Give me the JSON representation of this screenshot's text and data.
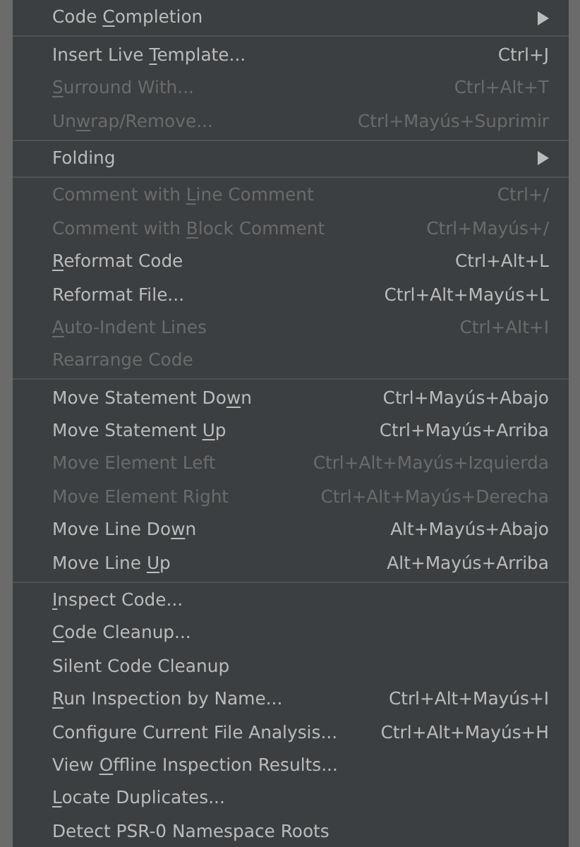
{
  "menu": {
    "sections": [
      [
        {
          "label": {
            "before": "Code ",
            "key": "C",
            "after": "ompletion"
          },
          "disabled": false,
          "submenu": true
        }
      ],
      [
        {
          "label": {
            "before": "Insert Live ",
            "key": "T",
            "after": "emplate..."
          },
          "shortcut": "Ctrl+J",
          "disabled": false
        },
        {
          "label": {
            "key": "S",
            "after": "urround With..."
          },
          "shortcut": "Ctrl+Alt+T",
          "disabled": true
        },
        {
          "label": {
            "before": "Un",
            "key": "w",
            "after": "rap/Remove..."
          },
          "shortcut": "Ctrl+Mayús+Suprimir",
          "disabled": true
        }
      ],
      [
        {
          "label": {
            "before": "Folding"
          },
          "disabled": false,
          "submenu": true
        }
      ],
      [
        {
          "label": {
            "before": "Comment with ",
            "key": "L",
            "after": "ine Comment"
          },
          "shortcut": "Ctrl+/",
          "disabled": true
        },
        {
          "label": {
            "before": "Comment with ",
            "key": "B",
            "after": "lock Comment"
          },
          "shortcut": "Ctrl+Mayús+/",
          "disabled": true
        },
        {
          "label": {
            "key": "R",
            "after": "eformat Code"
          },
          "shortcut": "Ctrl+Alt+L",
          "disabled": false
        },
        {
          "label": {
            "before": "Reformat File..."
          },
          "shortcut": "Ctrl+Alt+Mayús+L",
          "disabled": false
        },
        {
          "label": {
            "key": "A",
            "after": "uto-Indent Lines"
          },
          "shortcut": "Ctrl+Alt+I",
          "disabled": true
        },
        {
          "label": {
            "before": "Rearrange Code"
          },
          "disabled": true
        }
      ],
      [
        {
          "label": {
            "before": "Move Statement Do",
            "key": "w",
            "after": "n"
          },
          "shortcut": "Ctrl+Mayús+Abajo",
          "disabled": false
        },
        {
          "label": {
            "before": "Move Statement ",
            "key": "U",
            "after": "p"
          },
          "shortcut": "Ctrl+Mayús+Arriba",
          "disabled": false
        },
        {
          "label": {
            "before": "Move Element Left"
          },
          "shortcut": "Ctrl+Alt+Mayús+Izquierda",
          "disabled": true
        },
        {
          "label": {
            "before": "Move Element Right"
          },
          "shortcut": "Ctrl+Alt+Mayús+Derecha",
          "disabled": true
        },
        {
          "label": {
            "before": "Move Line Do",
            "key": "w",
            "after": "n"
          },
          "shortcut": "Alt+Mayús+Abajo",
          "disabled": false
        },
        {
          "label": {
            "before": "Move Line ",
            "key": "U",
            "after": "p"
          },
          "shortcut": "Alt+Mayús+Arriba",
          "disabled": false
        }
      ],
      [
        {
          "label": {
            "key": "I",
            "after": "nspect Code..."
          },
          "disabled": false
        },
        {
          "label": {
            "key": "C",
            "after": "ode Cleanup..."
          },
          "disabled": false
        },
        {
          "label": {
            "before": "Silent Code Cleanup"
          },
          "disabled": false
        },
        {
          "label": {
            "key": "R",
            "after": "un Inspection by Name..."
          },
          "shortcut": "Ctrl+Alt+Mayús+I",
          "disabled": false
        },
        {
          "label": {
            "before": "Configure Current File Analysis..."
          },
          "shortcut": "Ctrl+Alt+Mayús+H",
          "disabled": false
        },
        {
          "label": {
            "before": "View ",
            "key": "O",
            "after": "ffline Inspection Results..."
          },
          "disabled": false
        },
        {
          "label": {
            "key": "L",
            "after": "ocate Duplicates..."
          },
          "disabled": false
        },
        {
          "label": {
            "before": "Detect PSR-0 Namespace Roots"
          },
          "disabled": false
        }
      ]
    ]
  }
}
